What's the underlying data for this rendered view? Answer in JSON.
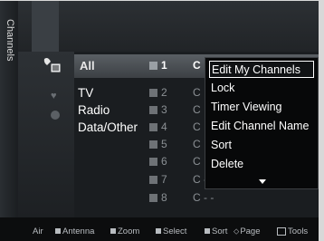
{
  "side_tab": {
    "label": "Channels"
  },
  "categories": [
    "All",
    "TV",
    "Radio",
    "Data/Other"
  ],
  "channels": [
    {
      "num": "1",
      "name": "C"
    },
    {
      "num": "2",
      "name": "C"
    },
    {
      "num": "3",
      "name": "C"
    },
    {
      "num": "4",
      "name": "C"
    },
    {
      "num": "5",
      "name": "C"
    },
    {
      "num": "6",
      "name": "C"
    },
    {
      "num": "7",
      "name": "C - -"
    },
    {
      "num": "8",
      "name": "C - -"
    }
  ],
  "menu": {
    "items": [
      "Edit My Channels",
      "Lock",
      "Timer Viewing",
      "Edit Channel Name",
      "Sort",
      "Delete"
    ]
  },
  "footer": {
    "source": "Air",
    "antenna": "Antenna",
    "zoom": "Zoom",
    "select": "Select",
    "sort": "Sort",
    "page": "Page",
    "tools": "Tools"
  }
}
